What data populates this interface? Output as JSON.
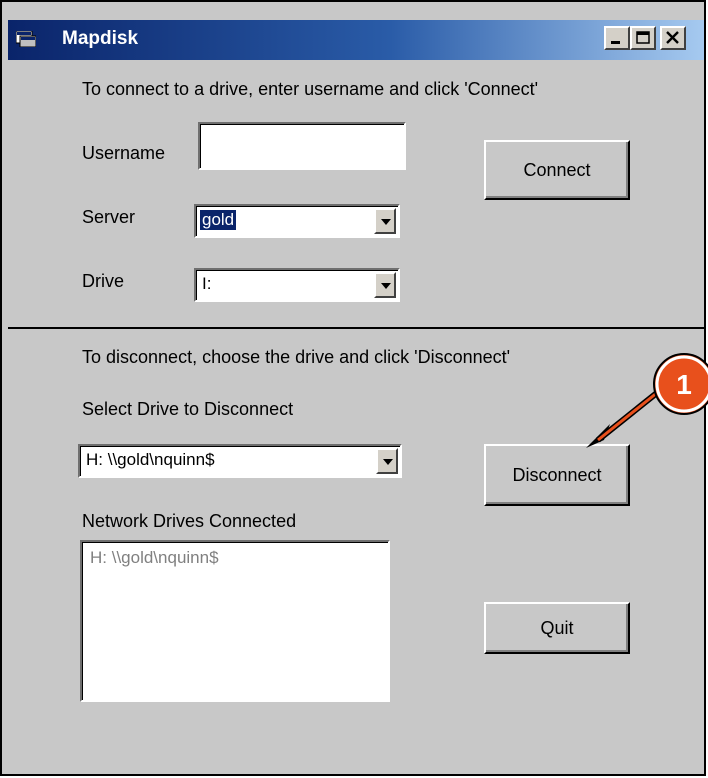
{
  "window": {
    "title": "Mapdisk",
    "app_icon": "window-app-icon",
    "controls": [
      "minimize-icon",
      "maximize-icon",
      "close-icon"
    ]
  },
  "connect_section": {
    "instruction": "To connect to a drive, enter username and click 'Connect'",
    "username_label": "Username",
    "username_value": "",
    "server_label": "Server",
    "server_value": "gold",
    "drive_label": "Drive",
    "drive_value": "I:",
    "connect_button": "Connect"
  },
  "disconnect_section": {
    "instruction": "To disconnect, choose the drive and click 'Disconnect'",
    "select_label": "Select Drive to Disconnect",
    "select_value": "H:  \\\\gold\\nquinn$",
    "disconnect_button": "Disconnect",
    "network_label": "Network Drives Connected",
    "network_items": [
      "H:  \\\\gold\\nquinn$"
    ],
    "quit_button": "Quit"
  },
  "callout": {
    "number": "1",
    "color": "#e8501c"
  },
  "colors": {
    "face": "#c8c8c8",
    "title_start": "#0a246a",
    "title_end": "#a6caf0",
    "selection": "#0a246a"
  }
}
